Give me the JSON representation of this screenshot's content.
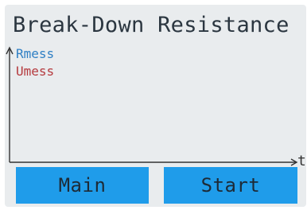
{
  "screen": {
    "title": "Break-Down Resistance",
    "legend": {
      "r_label": "Rmess",
      "u_label": "Umess"
    },
    "x_axis_label": "t",
    "buttons": {
      "main": "Main",
      "start": "Start"
    }
  },
  "colors": {
    "background": "#e9ecee",
    "button": "#1f9cea",
    "r_series": "#2f7fc4",
    "u_series": "#b53a3e"
  }
}
